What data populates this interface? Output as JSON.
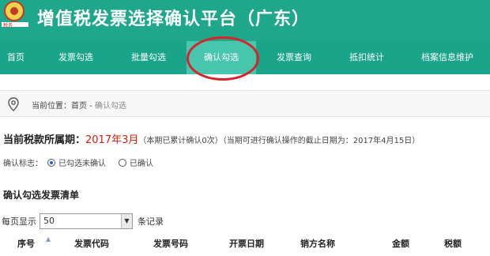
{
  "header": {
    "title": "增值税发票选择确认平台（广东）"
  },
  "nav": {
    "items": [
      {
        "label": "首页"
      },
      {
        "label": "发票勾选"
      },
      {
        "label": "批量勾选"
      },
      {
        "label": "确认勾选"
      },
      {
        "label": "发票查询"
      },
      {
        "label": "抵扣统计"
      },
      {
        "label": "档案信息维护"
      }
    ],
    "active": "确认勾选"
  },
  "breadcrumb": {
    "prefix": "当前位置：首页 - ",
    "current": "确认勾选"
  },
  "period": {
    "label": "当前税款所属期：",
    "value": "2017年3月",
    "note": "（本期已累计确认0次）（当期可进行确认操作的截止日期为：2017年4月15日）"
  },
  "confirm_flag": {
    "label": "确认标志：",
    "options": [
      {
        "label": "已勾选未确认",
        "checked": true
      },
      {
        "label": "已确认",
        "checked": false
      }
    ]
  },
  "list": {
    "title": "确认勾选发票清单",
    "page_size_prefix": "每页显示",
    "page_size_value": "50",
    "page_size_suffix": "条记录"
  },
  "table": {
    "columns": [
      "序号",
      "发票代码",
      "发票号码",
      "开票日期",
      "销方名称",
      "金额",
      "税额"
    ]
  },
  "colors": {
    "header_bg": "#1ea78a",
    "nav_active": "#47c6ad",
    "accent_red": "#d81e06",
    "highlight_ring": "#d7232a"
  }
}
